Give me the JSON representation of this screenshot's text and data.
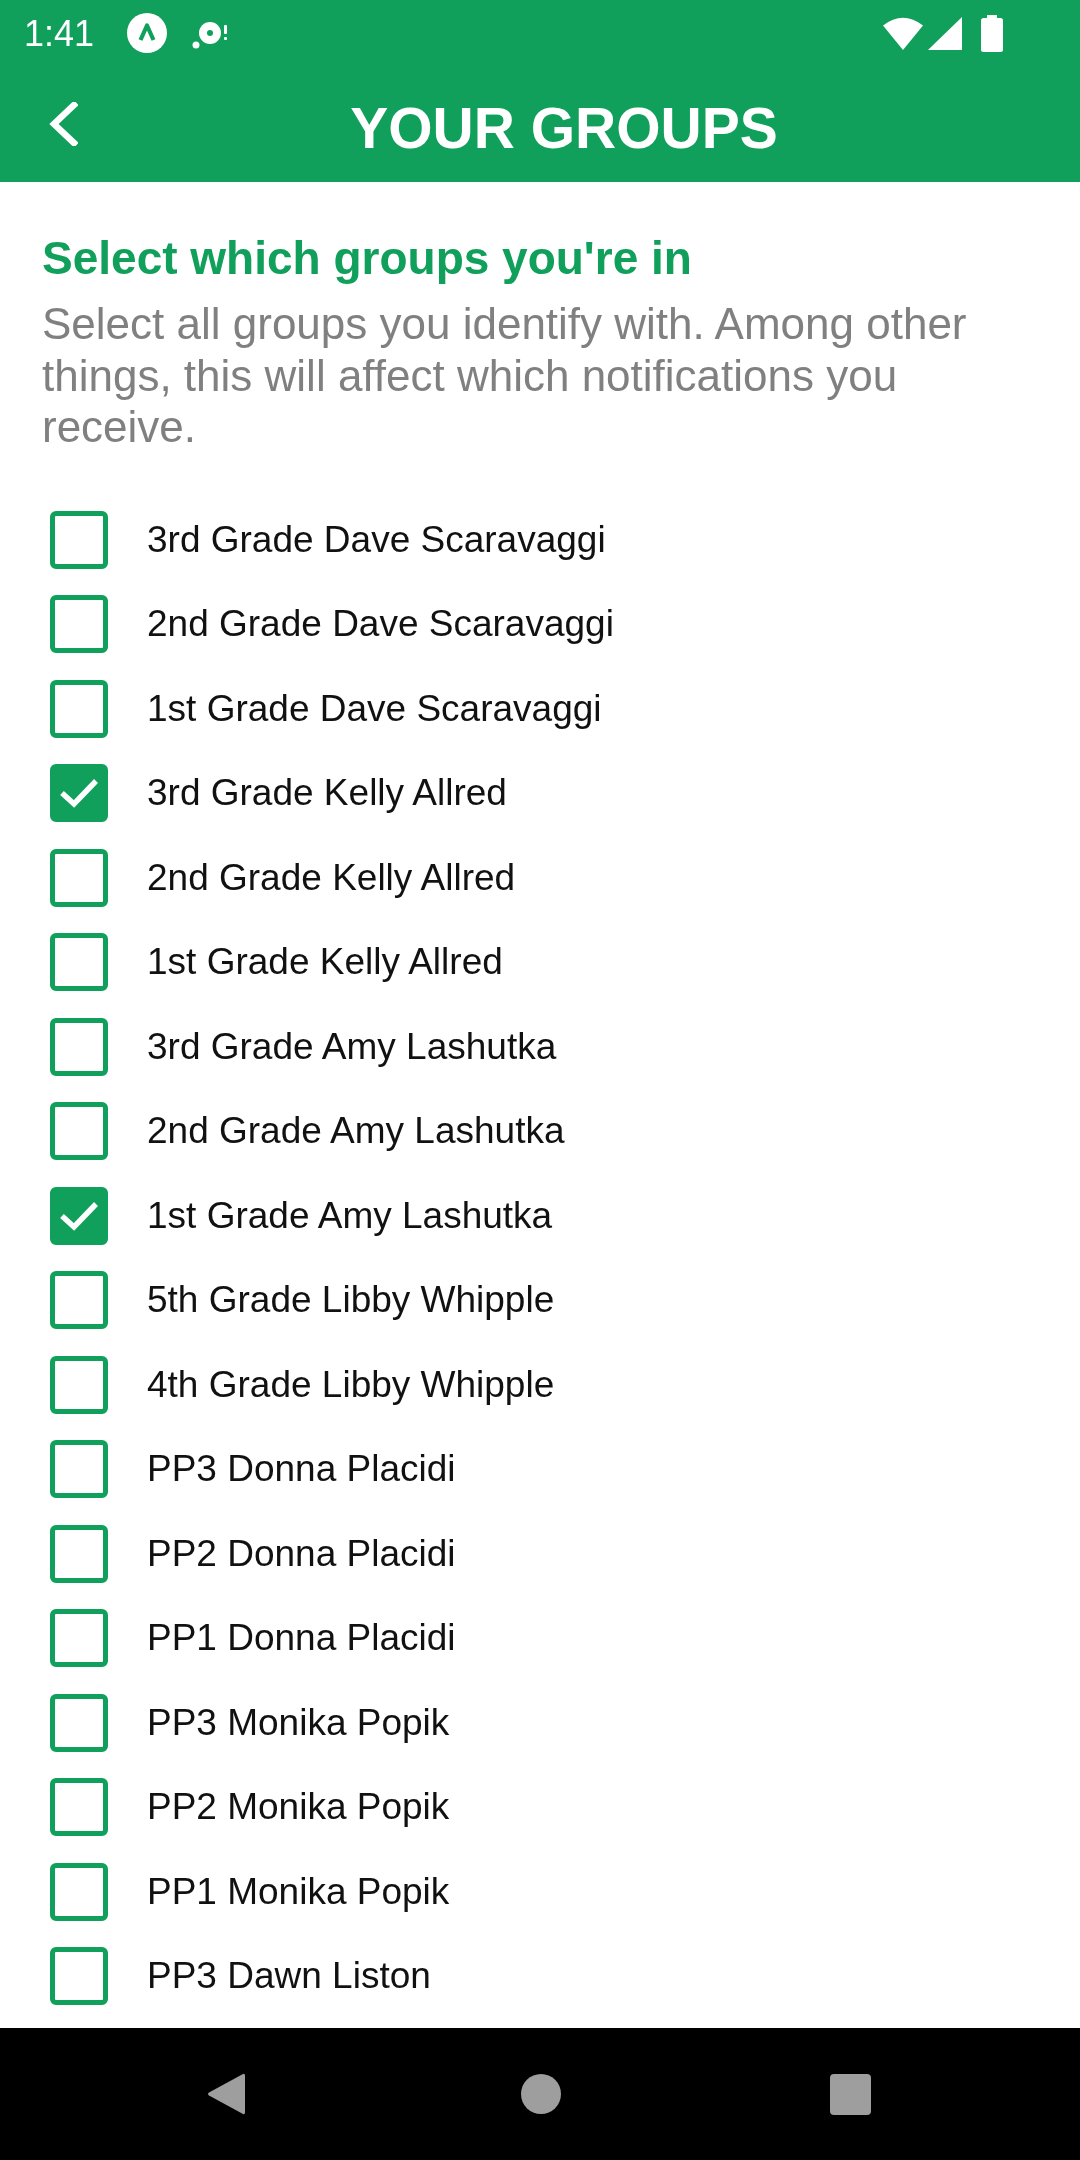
{
  "status_bar": {
    "time": "1:41"
  },
  "toolbar": {
    "title": "YOUR GROUPS"
  },
  "intro": {
    "heading": "Select which groups you're in",
    "description": "Select all groups you identify with. Among other things, this will affect which notifications you receive."
  },
  "groups": [
    {
      "label": "3rd Grade Dave Scaravaggi",
      "checked": false
    },
    {
      "label": "2nd Grade Dave Scaravaggi",
      "checked": false
    },
    {
      "label": "1st Grade Dave Scaravaggi",
      "checked": false
    },
    {
      "label": "3rd Grade Kelly Allred",
      "checked": true
    },
    {
      "label": "2nd Grade Kelly Allred",
      "checked": false
    },
    {
      "label": "1st Grade Kelly Allred",
      "checked": false
    },
    {
      "label": "3rd Grade Amy Lashutka",
      "checked": false
    },
    {
      "label": "2nd Grade Amy Lashutka",
      "checked": false
    },
    {
      "label": "1st Grade Amy Lashutka",
      "checked": true
    },
    {
      "label": "5th Grade Libby Whipple",
      "checked": false
    },
    {
      "label": "4th Grade Libby Whipple",
      "checked": false
    },
    {
      "label": "PP3 Donna Placidi",
      "checked": false
    },
    {
      "label": "PP2 Donna Placidi",
      "checked": false
    },
    {
      "label": "PP1 Donna Placidi",
      "checked": false
    },
    {
      "label": "PP3 Monika Popik",
      "checked": false
    },
    {
      "label": "PP2 Monika Popik",
      "checked": false
    },
    {
      "label": "PP1 Monika Popik",
      "checked": false
    },
    {
      "label": "PP3 Dawn Liston",
      "checked": false
    }
  ]
}
